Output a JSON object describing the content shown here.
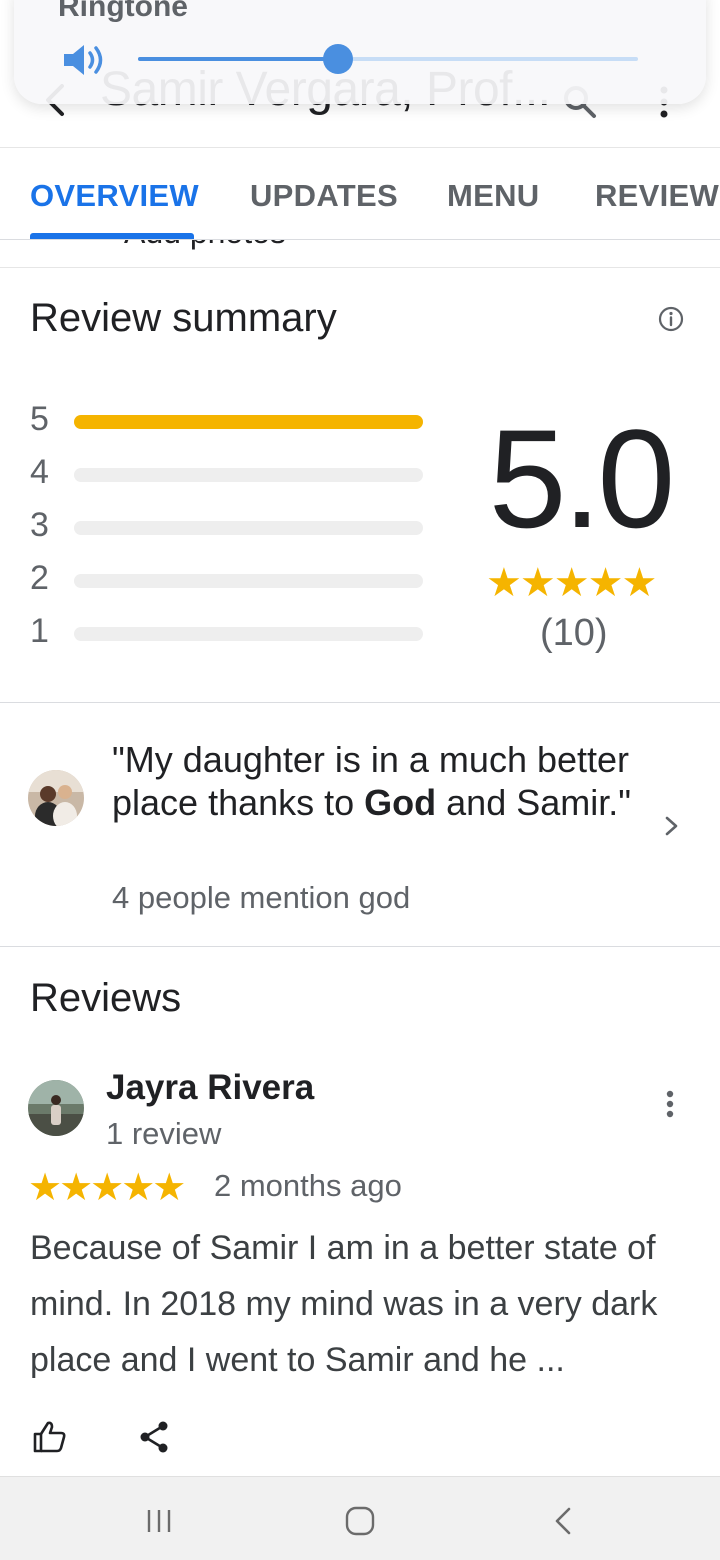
{
  "volume_panel": {
    "label": "Ringtone",
    "level": 0.4
  },
  "app_bar": {
    "title": "Samir Vergara, Prof..."
  },
  "tabs": [
    {
      "label": "OVERVIEW",
      "active": true
    },
    {
      "label": "UPDATES",
      "active": false
    },
    {
      "label": "MENU",
      "active": false
    },
    {
      "label": "REVIEWS",
      "active": false
    }
  ],
  "partial_row_text": "Add photos",
  "review_summary": {
    "title": "Review summary",
    "distribution": [
      {
        "stars": "5",
        "share": 1.0
      },
      {
        "stars": "4",
        "share": 0.0
      },
      {
        "stars": "3",
        "share": 0.0
      },
      {
        "stars": "2",
        "share": 0.0
      },
      {
        "stars": "1",
        "share": 0.0
      }
    ],
    "average": "5.0",
    "stars": "★★★★★",
    "count": "(10)"
  },
  "highlight": {
    "quote_before": "\"My daughter is in a much better place thanks to ",
    "quote_bold": "God",
    "quote_after": " and Samir.\"",
    "mention": "4 people mention god"
  },
  "reviews": {
    "title": "Reviews",
    "items": [
      {
        "author": "Jayra Rivera",
        "author_meta": "1 review",
        "stars": "★★★★★",
        "time": "2 months ago",
        "body": "Because of Samir I am in a better state of mind. In 2018 my mind was in a very dark place and I went to Samir and he ..."
      }
    ]
  },
  "colors": {
    "accent": "#1a73e8",
    "star": "#f5b400",
    "volume": "#4a8fe0"
  },
  "icons": {
    "back": "arrow-left-icon",
    "search": "search-icon",
    "more": "more-vert-icon",
    "info": "info-icon",
    "chevron": "chevron-right-icon",
    "like": "thumb-up-icon",
    "share": "share-icon",
    "speaker": "speaker-icon"
  }
}
